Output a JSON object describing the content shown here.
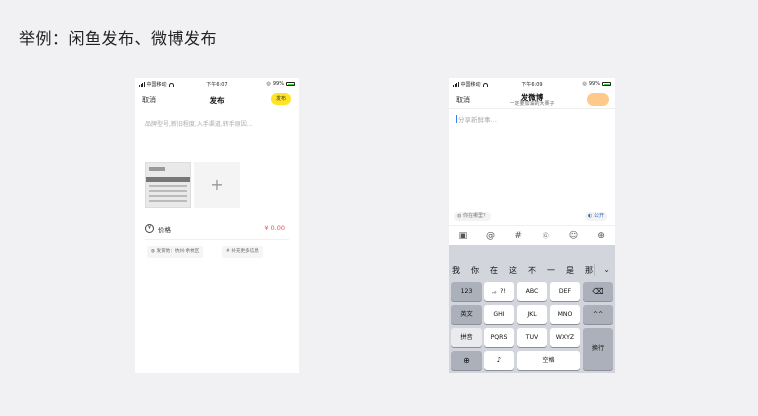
{
  "slide_title": "举例：闲鱼发布、微博发布",
  "xianyu": {
    "status": {
      "carrier": "中国移动",
      "time": "下午6:07",
      "battery": "99%"
    },
    "cancel": "取消",
    "title": "发布",
    "publish_button": "发布",
    "placeholder": "品牌型号,新旧程度,入手渠道,转手原因…",
    "add_photo": "+",
    "price_label": "价格",
    "price_value": "¥ 0.00",
    "tag_location": "发货地：杭州·余杭区",
    "tag_more": "补充更多信息"
  },
  "weibo": {
    "status": {
      "carrier": "中国移动",
      "time": "下午6:09",
      "battery": "99%"
    },
    "cancel": "取消",
    "title": "发微博",
    "subtitle": "一定要加油的大栗子",
    "input_placeholder": "分享新鲜事…",
    "location": "你在哪里？",
    "visibility": "公开",
    "tools": [
      "image-icon",
      "mention-icon",
      "hashtag-icon",
      "gif-icon",
      "emoji-icon",
      "more-icon"
    ],
    "candidates": [
      "我",
      "你",
      "在",
      "这",
      "不",
      "一",
      "是",
      "那"
    ],
    "keys": {
      "numbers": "123",
      "punct": ",。?!",
      "abc": "ABC",
      "def": "DEF",
      "english": "英文",
      "ghi": "GHI",
      "jkl": "JKL",
      "mno": "MNO",
      "pinyin": "拼音",
      "pqrs": "PQRS",
      "tuv": "TUV",
      "wxyz": "WXYZ",
      "space": "空格",
      "return": "换行"
    }
  }
}
